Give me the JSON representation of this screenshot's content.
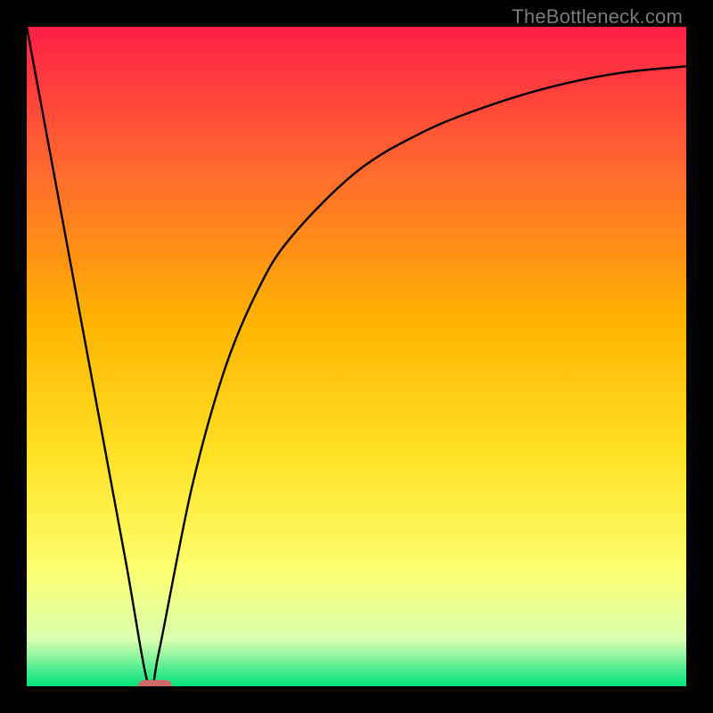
{
  "watermark": "TheBottleneck.com",
  "colors": {
    "top": "#ff1f47",
    "mid1": "#ff6a2e",
    "mid2": "#ffb400",
    "mid3": "#ffe328",
    "mid4": "#fdff6e",
    "mid5": "#d9ffb0",
    "bottom": "#00e27a",
    "curve": "#000000",
    "marker": "#cf6a6b"
  },
  "chart_data": {
    "type": "line",
    "categories_note": "x is normalized 0..1 across plot width; y is bottleneck % (0=ideal, 100=max)",
    "x": [
      0.0,
      0.05,
      0.1,
      0.15,
      0.185,
      0.2,
      0.25,
      0.3,
      0.35,
      0.4,
      0.5,
      0.6,
      0.7,
      0.8,
      0.9,
      1.0
    ],
    "values": [
      100,
      73,
      46,
      19,
      0,
      5,
      30,
      48,
      60,
      68,
      78,
      84,
      88,
      91,
      93,
      94
    ],
    "title": "",
    "xlabel": "",
    "ylabel": "",
    "xlim": [
      0,
      1
    ],
    "ylim": [
      0,
      100
    ],
    "optimum_x": 0.185,
    "marker": {
      "x": 0.195,
      "y": 0
    }
  }
}
